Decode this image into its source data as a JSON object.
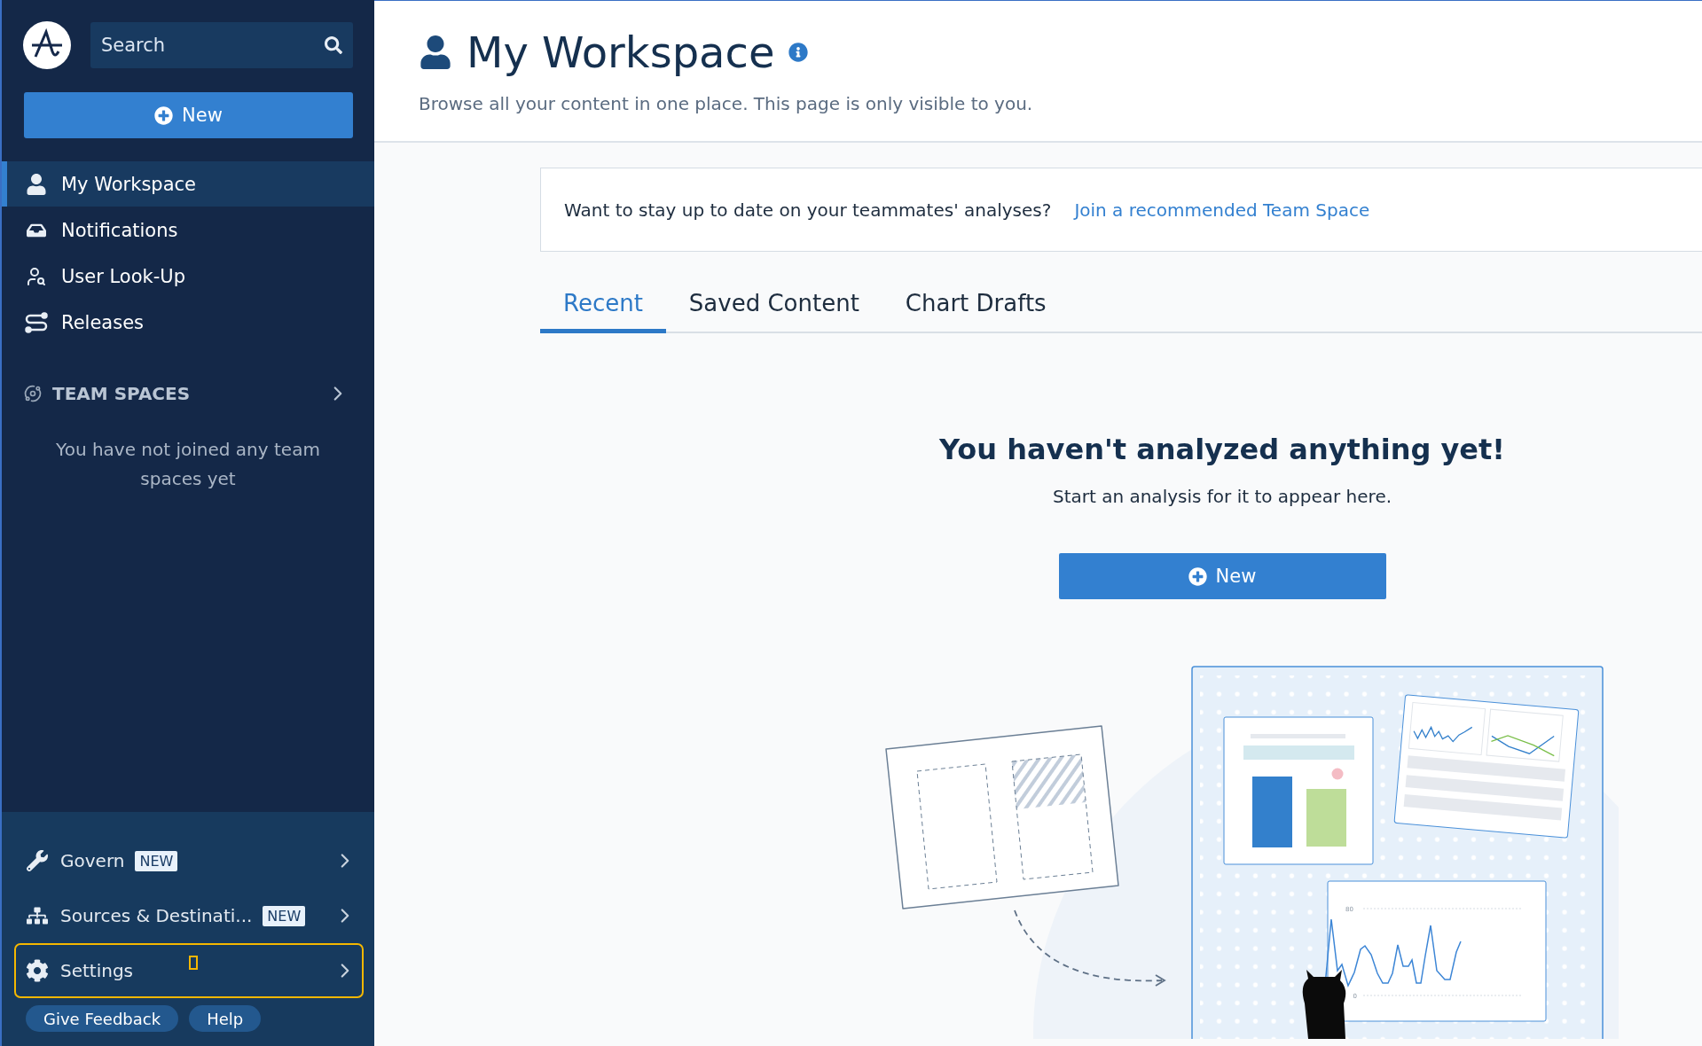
{
  "sidebar": {
    "search": {
      "placeholder": "Search"
    },
    "new_button": "New",
    "nav": [
      {
        "label": "My Workspace",
        "kind": "user",
        "selected": true
      },
      {
        "label": "Notifications",
        "kind": "inbox",
        "selected": false
      },
      {
        "label": "User Look-Up",
        "kind": "lookup",
        "selected": false
      },
      {
        "label": "Releases",
        "kind": "releases",
        "selected": false
      }
    ],
    "team_spaces": {
      "title": "TEAM SPACES",
      "empty_text": "You have not joined any team spaces yet"
    },
    "bottom_items": [
      {
        "label": "Govern",
        "kind": "wrench",
        "badge": "NEW",
        "focused": false
      },
      {
        "label": "Sources & Destinati...",
        "kind": "sitemap",
        "badge": "NEW",
        "focused": false
      },
      {
        "label": "Settings",
        "kind": "gear",
        "focused": true
      }
    ],
    "footer_buttons": [
      "Give Feedback",
      "Help"
    ]
  },
  "header": {
    "title": "My Workspace",
    "subtitle": "Browse all your content in one place. This page is only visible to you."
  },
  "banner": {
    "text": "Want to stay up to date on your teammates' analyses?",
    "link": "Join a recommended Team Space"
  },
  "tabs": [
    {
      "label": "Recent",
      "selected": true
    },
    {
      "label": "Saved Content",
      "selected": false
    },
    {
      "label": "Chart Drafts",
      "selected": false
    }
  ],
  "empty_state": {
    "heading": "You haven't analyzed anything yet!",
    "text": "Start an analysis for it to appear here.",
    "button": "New",
    "chart_ticks": [
      "80",
      "0"
    ]
  }
}
